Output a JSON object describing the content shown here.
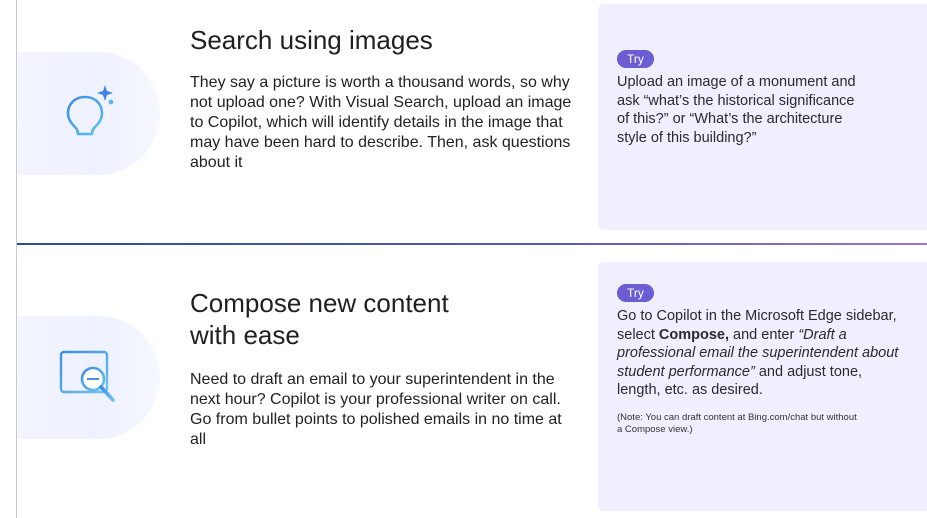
{
  "sections": [
    {
      "title": "Search using images",
      "icon": "lightbulb-sparkle-icon",
      "body": "They say a picture is worth a thousand words, so why not upload one? With Visual Search, upload an image to Copilot, which will identify details in the image that may have been hard to describe. Then, ask questions about it",
      "try_badge": "Try",
      "try_text": "Upload an image of a monument and ask “what’s the historical significance of this?” or “What’s the architecture style of this building?”"
    },
    {
      "title_line1": "Compose new content",
      "title_line2": "with ease",
      "icon": "document-magnifier-icon",
      "body": "Need to draft an email to your superintendent in the next hour? Copilot is your professional writer on call. Go from bullet points to polished emails in no time at all",
      "try_badge": "Try",
      "try_text_1": "Go to Copilot in the Microsoft Edge sidebar, select ",
      "try_text_bold": "Compose,",
      "try_text_2": " and enter ",
      "try_text_italic": "“Draft a professional email the superintendent about student performance”",
      "try_text_3": " and adjust tone, length, etc. as desired.",
      "try_note": "(Note: You can draft content at Bing.com/chat but without a Compose view.)"
    }
  ],
  "colors": {
    "accent": "#6b5dd2",
    "card_bg": "#f1efff",
    "icon_blue": "#4a8ee8",
    "divider_start": "#2d4f98",
    "divider_end": "#9f72d4"
  }
}
